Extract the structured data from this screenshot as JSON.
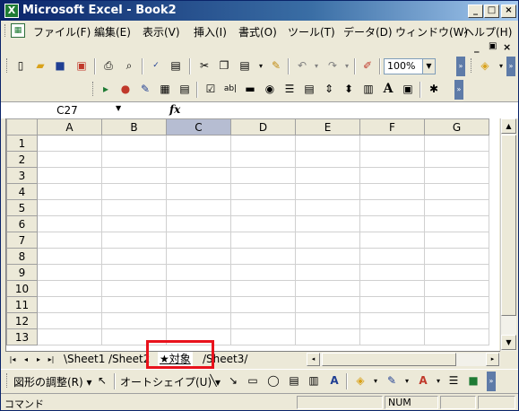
{
  "window": {
    "title": "Microsoft Excel - Book2",
    "controls": {
      "minimize": "_",
      "maximize": "□",
      "close": "×"
    }
  },
  "menu": {
    "items": [
      "ファイル(F)",
      "編集(E)",
      "表示(V)",
      "挿入(I)",
      "書式(O)",
      "ツール(T)",
      "データ(D)",
      "ウィンドウ(W)",
      "ヘルプ(H)"
    ],
    "doc_controls": {
      "minimize": "_",
      "restore": "ｑ",
      "close": "×"
    }
  },
  "standard_toolbar": {
    "zoom": "100%"
  },
  "formula_bar": {
    "name_box": "C27",
    "fx_label": "fx",
    "formula": ""
  },
  "grid": {
    "columns": [
      "A",
      "B",
      "C",
      "D",
      "E",
      "F",
      "G"
    ],
    "selected_column": "C",
    "rows": [
      "1",
      "2",
      "3",
      "4",
      "5",
      "6",
      "7",
      "8",
      "9",
      "10",
      "11",
      "12",
      "13"
    ]
  },
  "sheets": {
    "tabs": [
      "Sheet1",
      "Sheet2",
      "★対象",
      "Sheet3"
    ],
    "active": "★対象"
  },
  "drawing_toolbar": {
    "draw_menu": "図形の調整(R)",
    "autoshapes": "オートシェイプ(U)"
  },
  "status": {
    "mode": "コマンド",
    "num": "NUM"
  },
  "colors": {
    "title_start": "#0a246a",
    "title_end": "#a6caf0",
    "highlight": "#e8121c",
    "selected_header": "#b6bdd2",
    "chrome": "#ece9d8"
  }
}
